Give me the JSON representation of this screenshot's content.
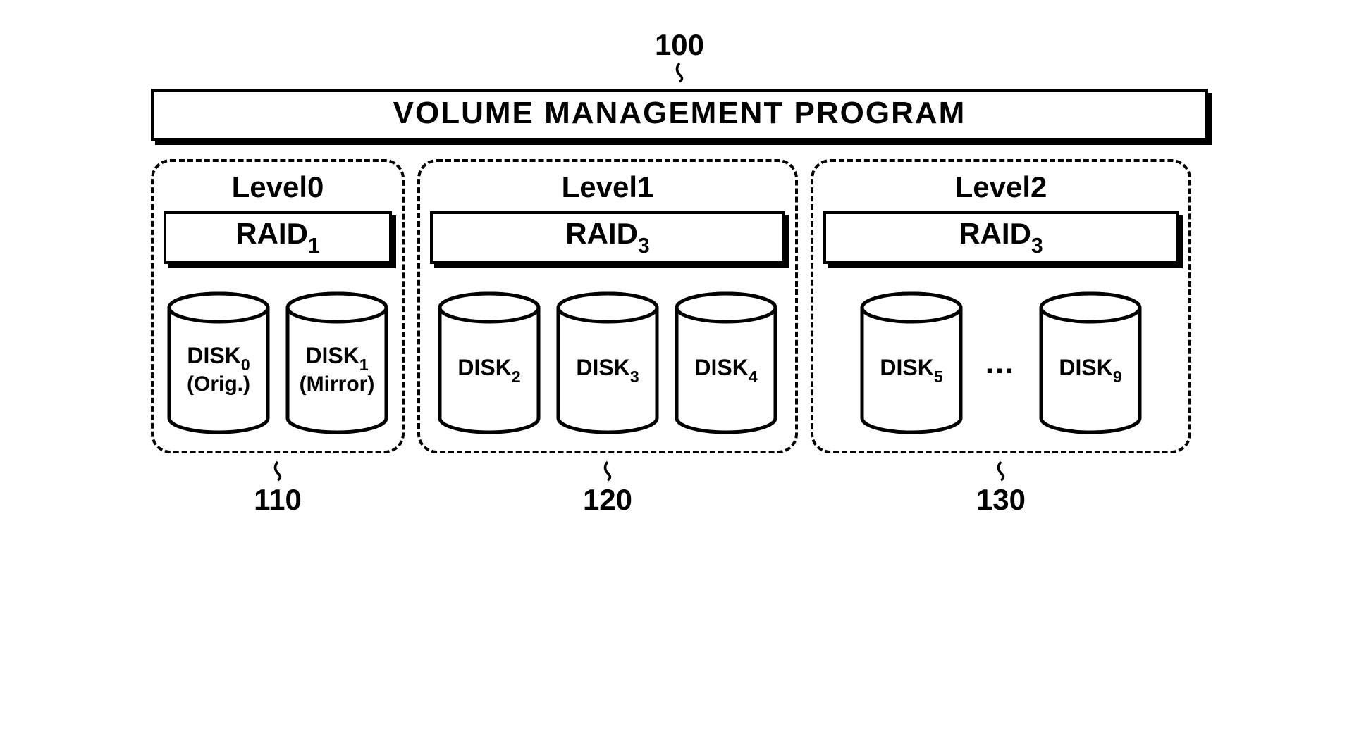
{
  "refs": {
    "top": "100",
    "level0": "110",
    "level1": "120",
    "level2": "130"
  },
  "vmp": {
    "title": "VOLUME MANAGEMENT PROGRAM"
  },
  "levels": {
    "l0": {
      "title": "Level0",
      "raid_prefix": "RAID",
      "raid_sub": "1",
      "disks": [
        {
          "prefix": "DISK",
          "sub": "0",
          "subtext": "(Orig.)"
        },
        {
          "prefix": "DISK",
          "sub": "1",
          "subtext": "(Mirror)"
        }
      ]
    },
    "l1": {
      "title": "Level1",
      "raid_prefix": "RAID",
      "raid_sub": "3",
      "disks": [
        {
          "prefix": "DISK",
          "sub": "2"
        },
        {
          "prefix": "DISK",
          "sub": "3"
        },
        {
          "prefix": "DISK",
          "sub": "4"
        }
      ]
    },
    "l2": {
      "title": "Level2",
      "raid_prefix": "RAID",
      "raid_sub": "3",
      "disk_start": {
        "prefix": "DISK",
        "sub": "5"
      },
      "ellipsis": "…",
      "disk_end": {
        "prefix": "DISK",
        "sub": "9"
      }
    }
  }
}
